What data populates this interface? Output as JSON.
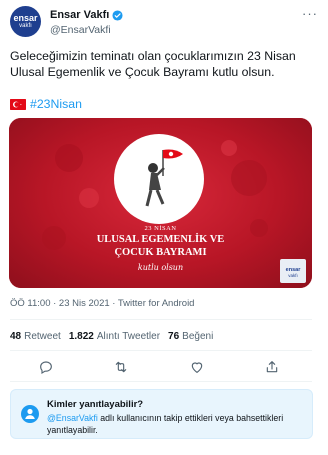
{
  "header": {
    "avatar_line1": "ensar",
    "avatar_line2": "vakfı",
    "display_name": "Ensar Vakfı",
    "handle": "@EnsarVakfi",
    "more_label": "···"
  },
  "tweet": {
    "text": "Geleceğimizin teminatı olan çocuklarımızın 23 Nisan Ulusal Egemenlik ve Çocuk Bayramı kutlu olsun.",
    "hashtag": "#23Nisan",
    "media": {
      "date_line": "23 NİSAN",
      "title_line1": "ULUSAL EGEMENLİK VE",
      "title_line2": "ÇOCUK BAYRAMI",
      "script_line": "kutlu olsun",
      "corner_line1": "ensar",
      "corner_line2": "vakfı"
    },
    "meta": "ÖÖ 11:00 · 23 Nis 2021 · Twitter for Android"
  },
  "stats": {
    "retweets_count": "48",
    "retweets_label": "Retweet",
    "quotes_count": "1.822",
    "quotes_label": "Alıntı Tweetler",
    "likes_count": "76",
    "likes_label": "Beğeni"
  },
  "actions": [
    "reply-icon",
    "retweet-icon",
    "like-icon",
    "share-icon"
  ],
  "reply_restriction": {
    "title": "Kimler yanıtlayabilir?",
    "mention": "@EnsarVakfi",
    "body": " adlı kullanıcının takip ettikleri veya bahsettikleri yanıtlayabilir."
  },
  "colors": {
    "accent": "#1d9bf0",
    "text": "#0f1419",
    "muted": "#536471",
    "media_red": "#c41b2a",
    "brand_blue": "#1f3f8f"
  }
}
